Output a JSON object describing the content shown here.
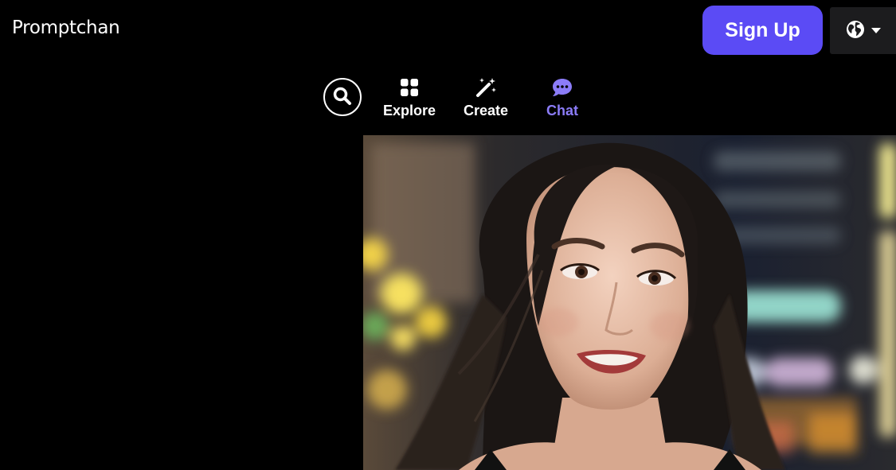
{
  "header": {
    "logo_text": "Promptchan",
    "signup_label": "Sign Up",
    "language_icon": "globe-icon",
    "dropdown_icon": "caret-down-icon"
  },
  "nav": {
    "search_icon": "search-icon",
    "items": [
      {
        "label": "Explore",
        "icon": "grid-icon",
        "active": false
      },
      {
        "label": "Create",
        "icon": "magic-wand-icon",
        "active": false
      },
      {
        "label": "Chat",
        "icon": "chat-bubble-icon",
        "active": true
      }
    ]
  },
  "colors": {
    "background": "#000000",
    "accent": "#5b4bf5",
    "active_nav": "#8b7cf8",
    "language_button_bg": "#1c1c1e"
  }
}
